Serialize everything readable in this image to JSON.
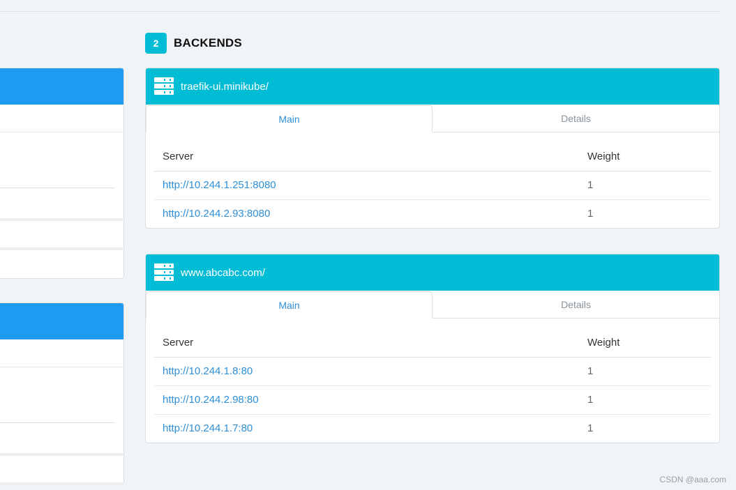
{
  "section": {
    "count": "2",
    "title": "BACKENDS"
  },
  "backends": [
    {
      "name": "traefik-ui.minikube/",
      "tabs": [
        {
          "label": "Main"
        },
        {
          "label": "Details"
        }
      ],
      "columns": {
        "server": "Server",
        "weight": "Weight"
      },
      "rows": [
        {
          "server": "http://10.244.1.251:8080",
          "weight": "1"
        },
        {
          "server": "http://10.244.2.93:8080",
          "weight": "1"
        }
      ]
    },
    {
      "name": "www.abcabc.com/",
      "tabs": [
        {
          "label": "Main"
        },
        {
          "label": "Details"
        }
      ],
      "columns": {
        "server": "Server",
        "weight": "Weight"
      },
      "rows": [
        {
          "server": "http://10.244.1.8:80",
          "weight": "1"
        },
        {
          "server": "http://10.244.2.98:80",
          "weight": "1"
        },
        {
          "server": "http://10.244.1.7:80",
          "weight": "1"
        }
      ]
    }
  ],
  "icons": {
    "backend_icon": "server-icon"
  },
  "colors": {
    "accent": "#00bcd4",
    "frontend_header": "#1e9bf0",
    "link": "#2e8fd8"
  },
  "watermark": "CSDN @aaa.com"
}
